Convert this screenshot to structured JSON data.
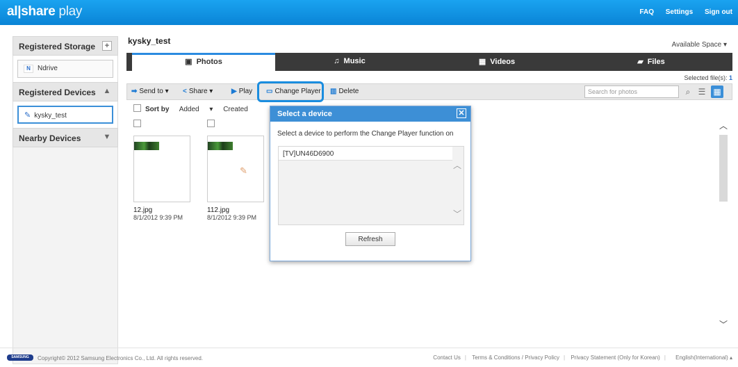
{
  "app": {
    "logo_main": "al|share",
    "logo_sub": " play"
  },
  "top_links": [
    "FAQ",
    "Settings",
    "Sign out"
  ],
  "sidebar": {
    "registered_storage": "Registered Storage",
    "storage_item": "Ndrive",
    "storage_badge": "N",
    "registered_devices": "Registered Devices",
    "device_item": "kysky_test",
    "nearby_devices": "Nearby Devices"
  },
  "main": {
    "title": "kysky_test",
    "available_space": "Available Space",
    "tabs": [
      "Photos",
      "Music",
      "Videos",
      "Files"
    ],
    "selected_files_label": "Selected file(s):",
    "selected_files_count": "1",
    "toolbar": {
      "send_to": "Send to",
      "share": "Share",
      "play": "Play",
      "change_player": "Change Player",
      "delete": "Delete",
      "search_placeholder": "Search for photos"
    },
    "sort": {
      "label": "Sort by",
      "added": "Added",
      "created": "Created"
    },
    "items": [
      {
        "name": "12.jpg",
        "date": "8/1/2012 9:39 PM"
      },
      {
        "name": "112.jpg",
        "date": "8/1/2012 9:39 PM"
      }
    ]
  },
  "dialog": {
    "title": "Select a device",
    "message": "Select a device to perform the Change Player function on",
    "devices": [
      "[TV]UN46D6900"
    ],
    "refresh": "Refresh"
  },
  "footer": {
    "samsung": "SAMSUNG",
    "copyright": "Copyright© 2012 Samsung Electronics Co., Ltd. All rights reserved.",
    "links": [
      "Contact Us",
      "Terms & Conditions / Privacy Policy",
      "Privacy Statement (Only for Korean)",
      "English(International)"
    ]
  },
  "colors": {
    "brand": "#0a84d6",
    "accent": "#1a8ddf",
    "dark_tab": "#3a3a3a"
  }
}
